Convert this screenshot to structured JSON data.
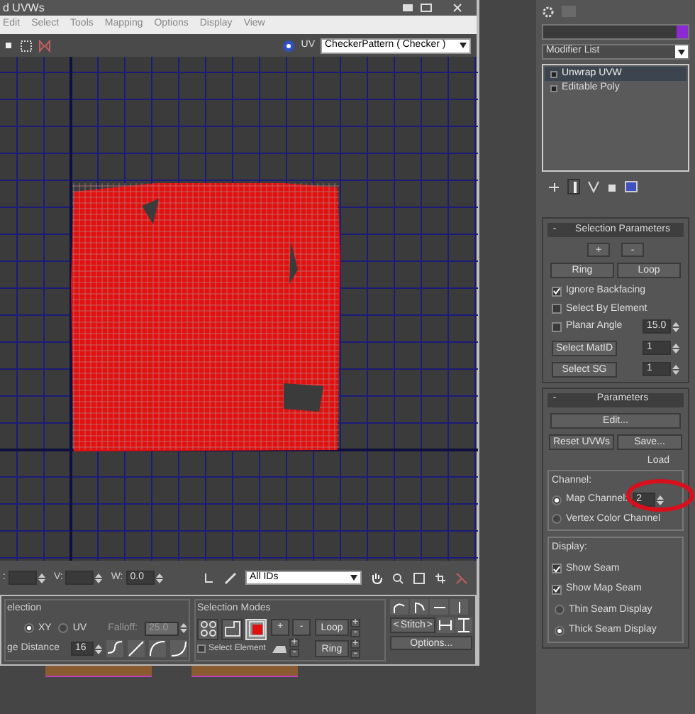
{
  "window": {
    "title": "d UVWs",
    "menu": [
      "Edit",
      "Select",
      "Tools",
      "Mapping",
      "Options",
      "Display",
      "View"
    ]
  },
  "toolbar": {
    "channel_label": "UV",
    "texture": "CheckerPattern ( Checker )"
  },
  "coords": [
    {
      "label": ":"
    },
    {
      "label": "V:"
    },
    {
      "label": "W:",
      "value": "0.0"
    }
  ],
  "id_filter": "All IDs",
  "soft_selection": {
    "title": "election",
    "space": [
      {
        "label": "XY",
        "selected": true
      },
      {
        "label": "UV",
        "selected": false
      }
    ],
    "falloff_label": "Falloff:",
    "falloff": "25.0",
    "falloff_disabled": true,
    "distance_label": "ge Distance",
    "distance": "16"
  },
  "selection_modes": {
    "title": "Selection Modes",
    "modes": [
      {
        "kind": "vertex",
        "selected": false
      },
      {
        "kind": "edge",
        "selected": false
      },
      {
        "kind": "face",
        "selected": true
      }
    ],
    "grow": "+",
    "shrink": "-",
    "select_element": {
      "label": "Select Element",
      "checked": false
    },
    "loop": "Loop",
    "ring": "Ring",
    "plus": "+",
    "minus": "-"
  },
  "stitch": {
    "left": "<",
    "label": "Stitch",
    "right": ">",
    "options": "Options..."
  },
  "modifier_list": "Modifier List",
  "stack": [
    {
      "label": "Unwrap UVW",
      "selected": true
    },
    {
      "label": "Editable Poly",
      "selected": false
    }
  ],
  "collapse_sign": "-",
  "selection_parameters": {
    "title": "Selection Parameters",
    "grow": "+",
    "shrink": "-",
    "ring": "Ring",
    "loop": "Loop",
    "checks": [
      {
        "label": "Ignore Backfacing",
        "checked": true
      },
      {
        "label": "Select By Element",
        "checked": false
      },
      {
        "label": "Planar Angle",
        "checked": false,
        "value": "15.0"
      }
    ],
    "select_buttons": [
      {
        "label": "Select MatID",
        "value": "1"
      },
      {
        "label": "Select SG",
        "value": "1"
      }
    ]
  },
  "parameters": {
    "title": "Parameters",
    "edit": "Edit...",
    "reset": "Reset UVWs",
    "save": "Save...",
    "load": "Load",
    "channel_title": "Channel:",
    "channels": [
      {
        "label": "Map Channel:",
        "selected": true,
        "value": "2"
      },
      {
        "label": "Vertex Color Channel",
        "selected": false
      }
    ],
    "display_title": "Display:",
    "display_checks": [
      {
        "label": "Show Seam",
        "checked": true
      },
      {
        "label": "Show Map Seam",
        "checked": true
      }
    ],
    "seam_modes": [
      {
        "label": "Thin Seam Display",
        "selected": false
      },
      {
        "label": "Thick Seam Display",
        "selected": true
      }
    ]
  }
}
